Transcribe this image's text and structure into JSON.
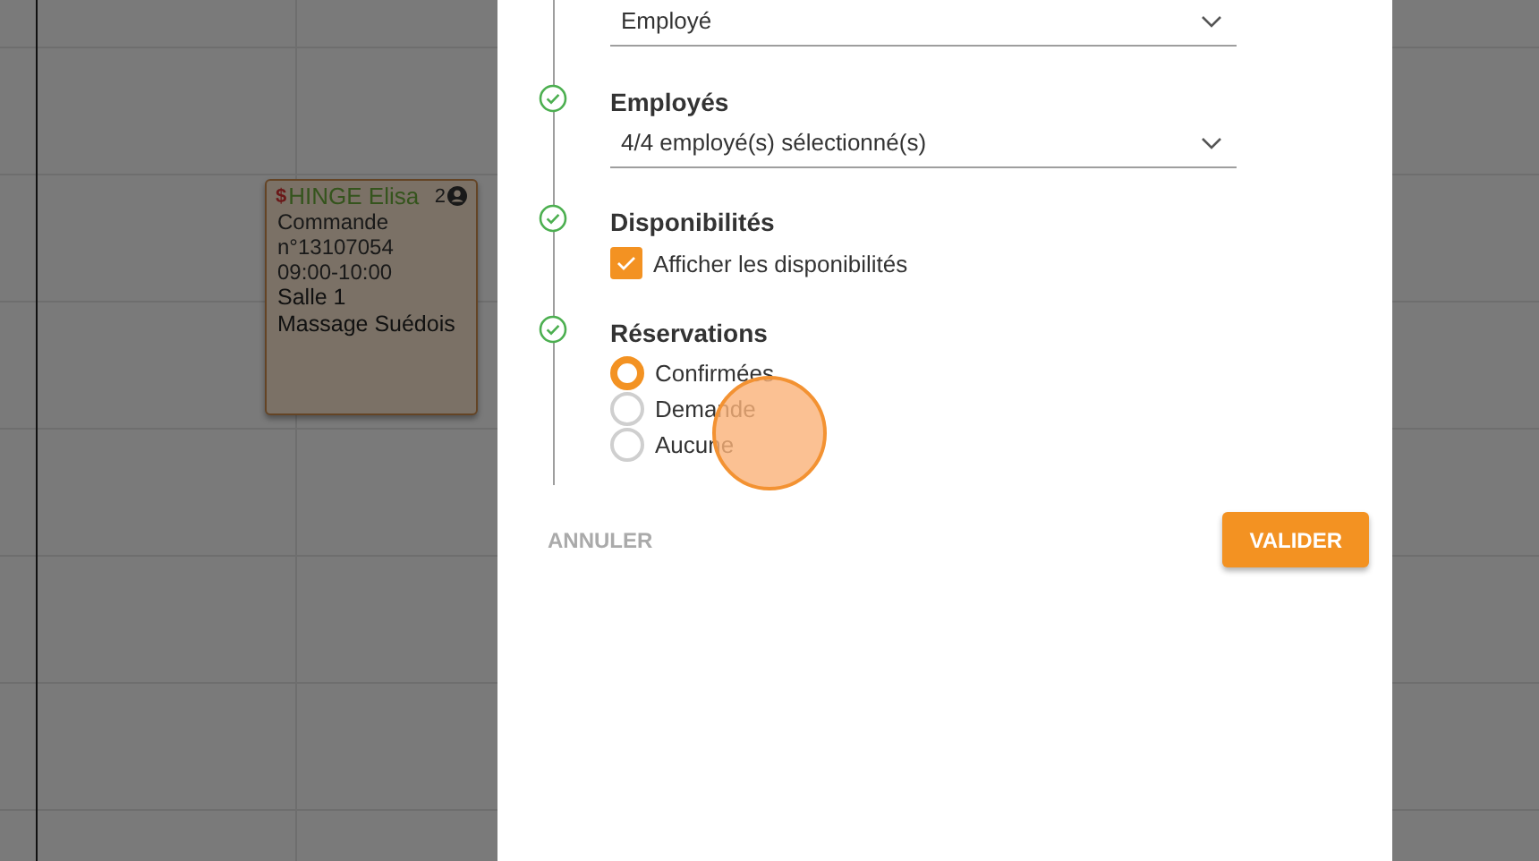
{
  "calendar": {
    "event": {
      "payment_icon": "$",
      "client": "HINGE Elisa",
      "count": "2",
      "lines": [
        "Commande",
        "n°13107054",
        "09:00-10:00"
      ],
      "room": "Salle 1",
      "service": "Massage Suédois"
    }
  },
  "dialog": {
    "steps": [
      {
        "kind": "select",
        "value": "Employé"
      },
      {
        "kind": "select",
        "title": "Employés",
        "done": true,
        "value": "4/4 employé(s) sélectionné(s)"
      },
      {
        "kind": "checkbox",
        "title": "Disponibilités",
        "done": true,
        "option": {
          "label": "Afficher les disponibilités",
          "checked": true
        }
      },
      {
        "kind": "radio",
        "title": "Réservations",
        "done": true,
        "options": [
          {
            "label": "Confirmées",
            "selected": true
          },
          {
            "label": "Demande",
            "selected": false
          },
          {
            "label": "Aucune",
            "selected": false
          }
        ]
      }
    ],
    "cancel": "ANNULER",
    "confirm": "VALIDER"
  },
  "touch_indicator": {
    "kind": "tap"
  }
}
